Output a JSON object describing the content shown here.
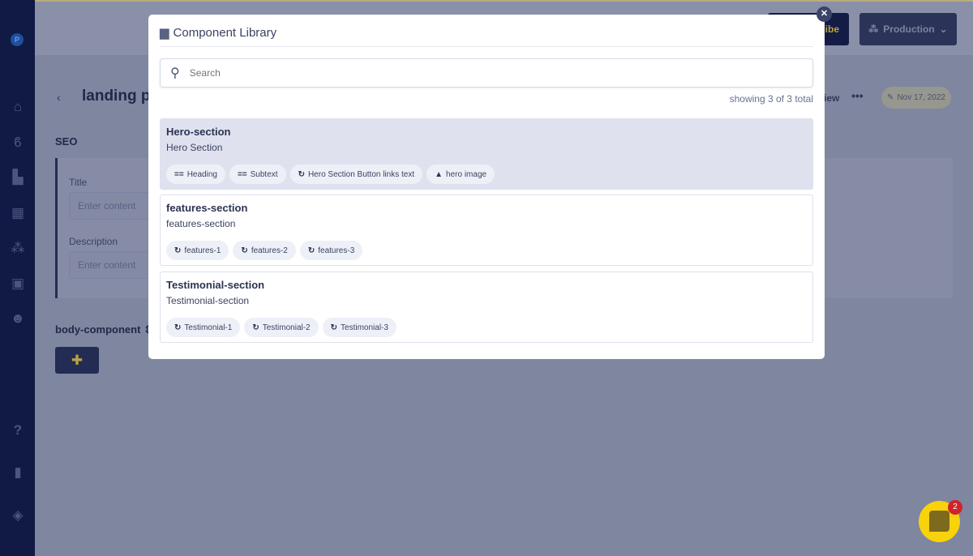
{
  "sidebar": {
    "avatar": "P",
    "icons": [
      "home-icon",
      "blog-icon",
      "page-icon",
      "table-icon",
      "components-icon",
      "media-icon",
      "users-icon",
      "help-icon",
      "docs-icon",
      "layers-icon"
    ]
  },
  "topbar": {
    "subscribe_partial": "ibe",
    "environment": "Production"
  },
  "page": {
    "title": "landing pa",
    "seo_label": "SEO",
    "fields": [
      {
        "label": "Title",
        "placeholder": "Enter content"
      },
      {
        "label": "Description",
        "placeholder": "Enter content"
      }
    ],
    "body_component": "body-component",
    "preview_partial": "iew",
    "date": "Nov 17, 2022"
  },
  "modal": {
    "title": "Component Library",
    "search_placeholder": "Search",
    "count": "showing 3 of 3 total",
    "cards": [
      {
        "title": "Hero-section",
        "subtitle": "Hero Section",
        "active": true,
        "chips": [
          {
            "icon": "text-icon",
            "label": "Heading"
          },
          {
            "icon": "text-icon",
            "label": "Subtext"
          },
          {
            "icon": "repeat-icon",
            "label": "Hero Section Button links text"
          },
          {
            "icon": "image-icon",
            "label": "hero image"
          }
        ]
      },
      {
        "title": "features-section",
        "subtitle": "features-section",
        "chips": [
          {
            "icon": "repeat-icon",
            "label": "features-1"
          },
          {
            "icon": "repeat-icon",
            "label": "features-2"
          },
          {
            "icon": "repeat-icon",
            "label": "features-3"
          }
        ]
      },
      {
        "title": "Testimonial-section",
        "subtitle": "Testimonial-section",
        "chips": [
          {
            "icon": "repeat-icon",
            "label": "Testimonial-1"
          },
          {
            "icon": "repeat-icon",
            "label": "Testimonial-2"
          },
          {
            "icon": "repeat-icon",
            "label": "Testimonial-3"
          }
        ]
      }
    ]
  },
  "chat": {
    "badge": "2",
    "color": "#f8d20a"
  }
}
